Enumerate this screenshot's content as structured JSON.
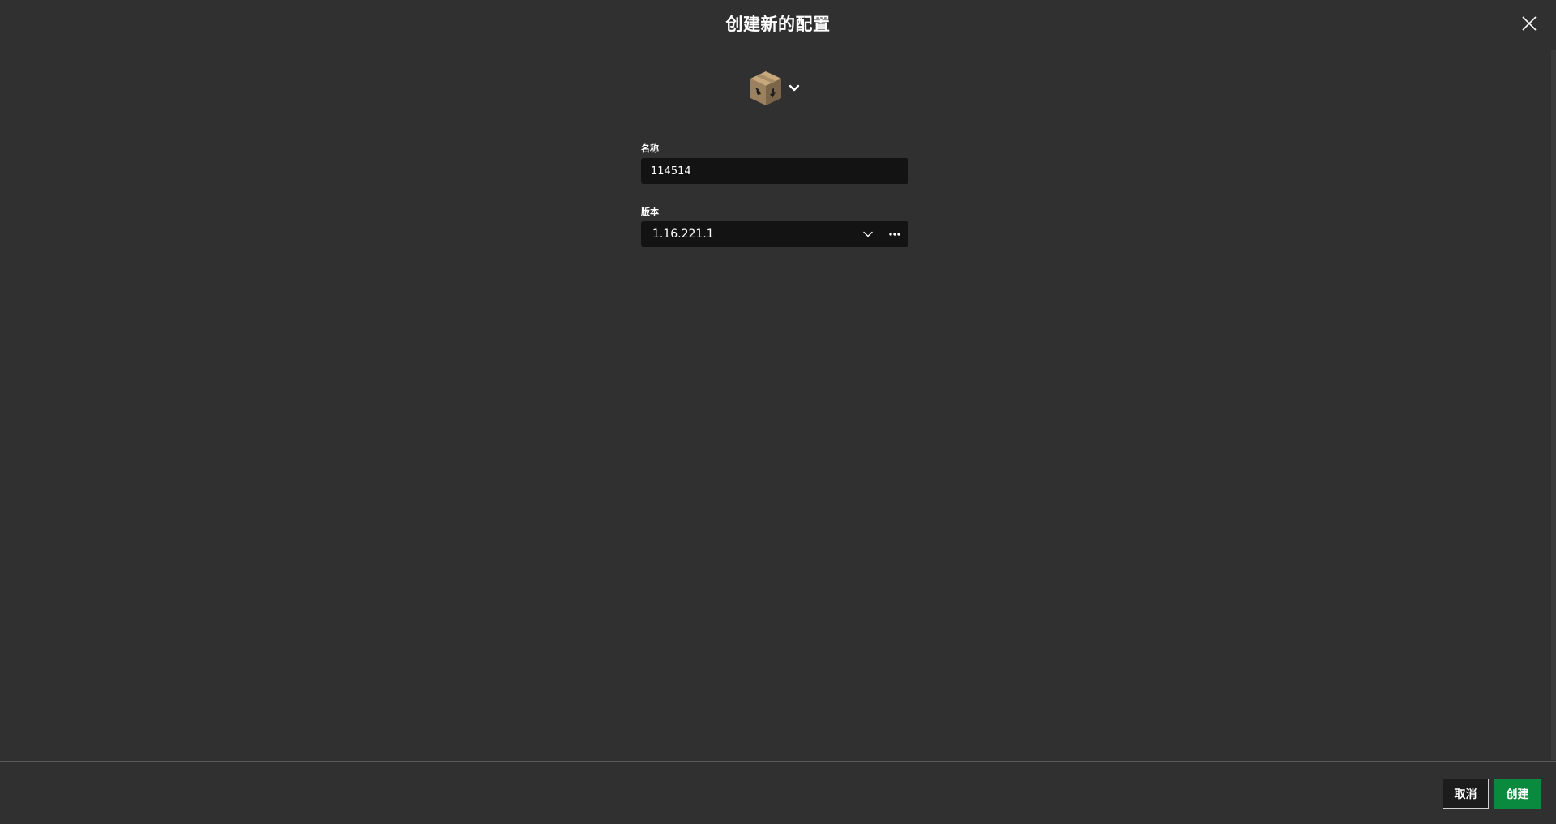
{
  "dialog": {
    "title": "创建新的配置",
    "close_icon": "close-icon"
  },
  "icon_picker": {
    "icon": "crafting-box-icon",
    "dropdown_icon": "chevron-down-icon"
  },
  "form": {
    "name": {
      "label": "名称",
      "value": "114514"
    },
    "version": {
      "label": "版本",
      "value": "1.16.221.1",
      "dropdown_icon": "chevron-down-icon",
      "more_icon": "ellipsis-icon"
    }
  },
  "footer": {
    "cancel_label": "取消",
    "create_label": "创建"
  },
  "colors": {
    "background": "#303030",
    "input_background": "#131313",
    "accent_green": "#0a8a3e",
    "divider": "#5a5a5a"
  }
}
